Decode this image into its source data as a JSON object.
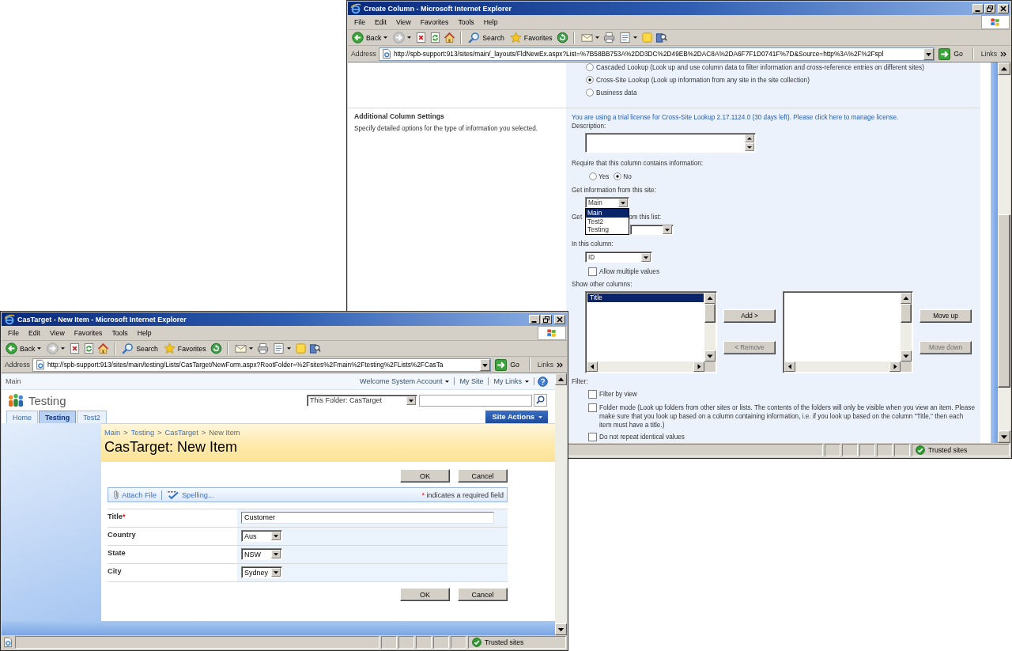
{
  "create_column_window": {
    "title": "Create Column - Microsoft Internet Explorer",
    "menu": [
      "File",
      "Edit",
      "View",
      "Favorites",
      "Tools",
      "Help"
    ],
    "toolbar": {
      "back": "Back",
      "search": "Search",
      "favorites": "Favorites"
    },
    "address": {
      "label": "Address",
      "url": "http://spb-support:913/sites/main/_layouts/FldNewEx.aspx?List=%7B58BB753A%2DD3DC%2D49EB%2DAC8A%2DA6F7F1D0741F%7D&Source=http%3A%2F%2Fspl",
      "go": "Go",
      "links": "Links"
    },
    "page": {
      "type_options": [
        {
          "label": "Cascaded Lookup (Look up and use column data to filter information and cross-reference entries on different sites)",
          "selected": false
        },
        {
          "label": "Cross-Site Lookup (Look up information from any site in the site collection)",
          "selected": true
        },
        {
          "label": "Business data",
          "selected": false
        }
      ],
      "section": {
        "title": "Additional Column Settings",
        "description": "Specify detailed options for the type of information you selected."
      },
      "license_notice": "You are using a trial license for Cross-Site Lookup 2.17.1124.0 (30 days left). Please click here to manage license.",
      "description_label": "Description:",
      "require_label": "Require that this column contains information:",
      "require_options": [
        {
          "label": "Yes",
          "selected": false
        },
        {
          "label": "No",
          "selected": true
        }
      ],
      "site_label": "Get information from this site:",
      "site_select": {
        "value": "Main",
        "expanded": true,
        "options": [
          {
            "label": "Main",
            "selected": true
          },
          {
            "label": "Test2",
            "selected": false
          },
          {
            "label": "Testing",
            "selected": false
          }
        ]
      },
      "list_label_parts": [
        "Get",
        "om this list:"
      ],
      "column_label": "In this column:",
      "column_select": "ID",
      "allow_multiple": {
        "label": "Allow multiple values",
        "checked": false
      },
      "show_columns_label": "Show other columns:",
      "available_columns": [
        {
          "label": "Title",
          "selected": true
        }
      ],
      "add_button": {
        "label": "Add >",
        "disabled": false
      },
      "remove_button": {
        "label": "< Remove",
        "disabled": true
      },
      "move_up_button": {
        "label": "Move up",
        "disabled": false
      },
      "move_down_button": {
        "label": "Move down",
        "disabled": true
      },
      "filter_label": "Filter:",
      "filter_options": [
        {
          "label": "Filter by view",
          "checked": false
        },
        {
          "label": "Folder mode (Look up folders from other sites or lists. The contents of the folders will only be visible when you view an item. Please make sure that you look up based on a column containing information, i.e. if you look up based on the column \"Title,\" then each item must have a title.)",
          "checked": false
        },
        {
          "label": "Do not repeat identical values",
          "checked": false
        }
      ]
    },
    "status": {
      "zone": "Trusted sites"
    }
  },
  "new_item_window": {
    "title": "CasTarget - New Item - Microsoft Internet Explorer",
    "menu": [
      "File",
      "Edit",
      "View",
      "Favorites",
      "Tools",
      "Help"
    ],
    "toolbar": {
      "back": "Back",
      "search": "Search",
      "favorites": "Favorites"
    },
    "address": {
      "label": "Address",
      "url": "http://spb-support:913/sites/main/testing/Lists/CasTarget/NewForm.aspx?RootFolder=%2Fsites%2Fmain%2Ftesting%2FLists%2FCasTa",
      "go": "Go",
      "links": "Links"
    },
    "page": {
      "top_link": "Main",
      "user_links": [
        {
          "label": "Welcome System Account",
          "has_menu": true
        },
        {
          "label": "My Site",
          "has_menu": false
        },
        {
          "label": "My Links",
          "has_menu": true
        }
      ],
      "site_title": "Testing",
      "search_scope": "This Folder: CasTarget",
      "tabs": [
        {
          "label": "Home",
          "selected": false
        },
        {
          "label": "Testing",
          "selected": true
        },
        {
          "label": "Test2",
          "selected": false
        }
      ],
      "site_actions": "Site Actions",
      "breadcrumb": [
        {
          "label": "Main",
          "kind": "link"
        },
        {
          "label": ">",
          "kind": "separator"
        },
        {
          "label": "Testing",
          "kind": "link"
        },
        {
          "label": ">",
          "kind": "separator"
        },
        {
          "label": "CasTarget",
          "kind": "link"
        },
        {
          "label": ">",
          "kind": "separator"
        },
        {
          "label": "New Item",
          "kind": "current"
        }
      ],
      "page_title": "CasTarget: New Item",
      "top_buttons": [
        "OK",
        "Cancel"
      ],
      "form_toolbar": {
        "attach": "Attach File",
        "spelling": "Spelling...",
        "required_mark": "*",
        "required_note": "indicates a required field"
      },
      "fields": [
        {
          "label": "Title",
          "required_mark": "*",
          "kind": "text",
          "value": "Customer"
        },
        {
          "label": "Country",
          "kind": "select",
          "value": "Aus"
        },
        {
          "label": "State",
          "kind": "select",
          "value": "NSW"
        },
        {
          "label": "City",
          "kind": "select",
          "value": "Sydney"
        }
      ],
      "bottom_buttons": [
        "OK",
        "Cancel"
      ]
    },
    "status": {
      "zone": "Trusted sites"
    }
  }
}
